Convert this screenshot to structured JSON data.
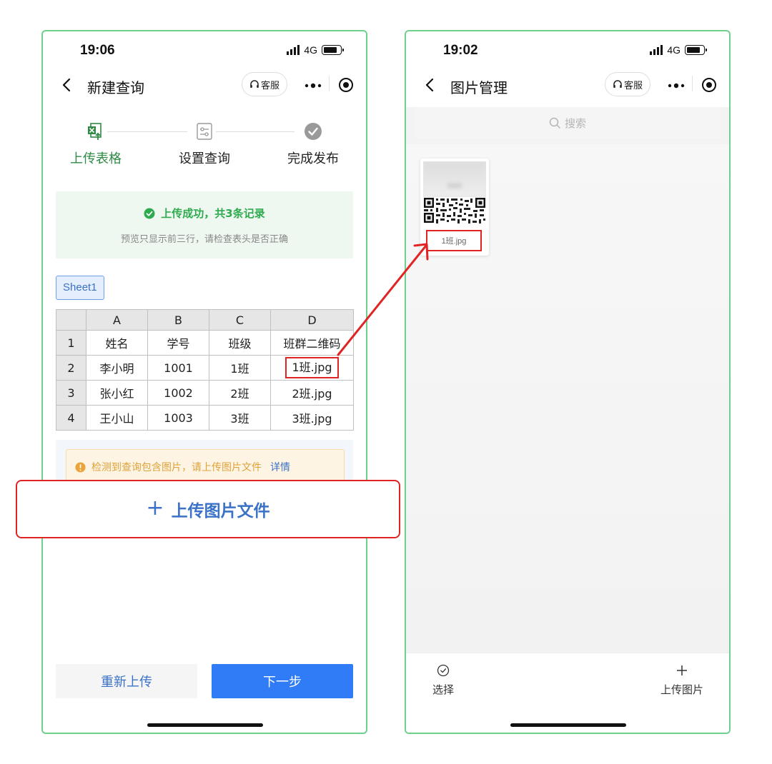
{
  "left_screen": {
    "status": {
      "time": "19:06",
      "network": "4G"
    },
    "nav": {
      "title": "新建查询",
      "service_label": "客服"
    },
    "steps": [
      {
        "label": "上传表格",
        "state": "active"
      },
      {
        "label": "设置查询",
        "state": "pending"
      },
      {
        "label": "完成发布",
        "state": "pending"
      }
    ],
    "success": {
      "title": "上传成功，共3条记录",
      "subtitle": "预览只显示前三行，请检查表头是否正确"
    },
    "sheet_tab": "Sheet1",
    "table": {
      "columns": [
        "A",
        "B",
        "C",
        "D"
      ],
      "rows": [
        {
          "num": "1",
          "cells": [
            "姓名",
            "学号",
            "班级",
            "班群二维码"
          ]
        },
        {
          "num": "2",
          "cells": [
            "李小明",
            "1001",
            "1班",
            "1班.jpg"
          ]
        },
        {
          "num": "3",
          "cells": [
            "张小红",
            "1002",
            "2班",
            "2班.jpg"
          ]
        },
        {
          "num": "4",
          "cells": [
            "王小山",
            "1003",
            "3班",
            "3班.jpg"
          ]
        }
      ]
    },
    "warning": {
      "text": "检测到查询包含图片，请上传图片文件",
      "link": "详情"
    },
    "upload_button": {
      "plus": "+",
      "label": "上传图片文件"
    },
    "buttons": {
      "reupload": "重新上传",
      "next": "下一步"
    }
  },
  "right_screen": {
    "status": {
      "time": "19:02",
      "network": "4G"
    },
    "nav": {
      "title": "图片管理",
      "service_label": "客服"
    },
    "search": {
      "placeholder": "搜索"
    },
    "images": [
      {
        "filename": "1班.jpg"
      }
    ],
    "toolbar": {
      "select": "选择",
      "upload": "上传图片"
    }
  },
  "colors": {
    "frame": "#6fcf8c",
    "accent_green": "#2faa4f",
    "accent_blue": "#2f7cf6",
    "link_blue": "#3b72c8",
    "highlight_red": "#e02424",
    "warning_orange": "#e0a23a"
  },
  "icons": {
    "back": "chevron-left-icon",
    "service": "headset-icon",
    "more": "more-dots-icon",
    "close_target": "target-icon",
    "step1": "excel-upload-icon",
    "step2": "settings-sliders-icon",
    "step3": "check-circle-icon",
    "success": "check-circle-icon",
    "warning": "info-circle-icon",
    "search": "search-icon",
    "select": "check-circle-outline-icon",
    "upload": "plus-icon"
  }
}
